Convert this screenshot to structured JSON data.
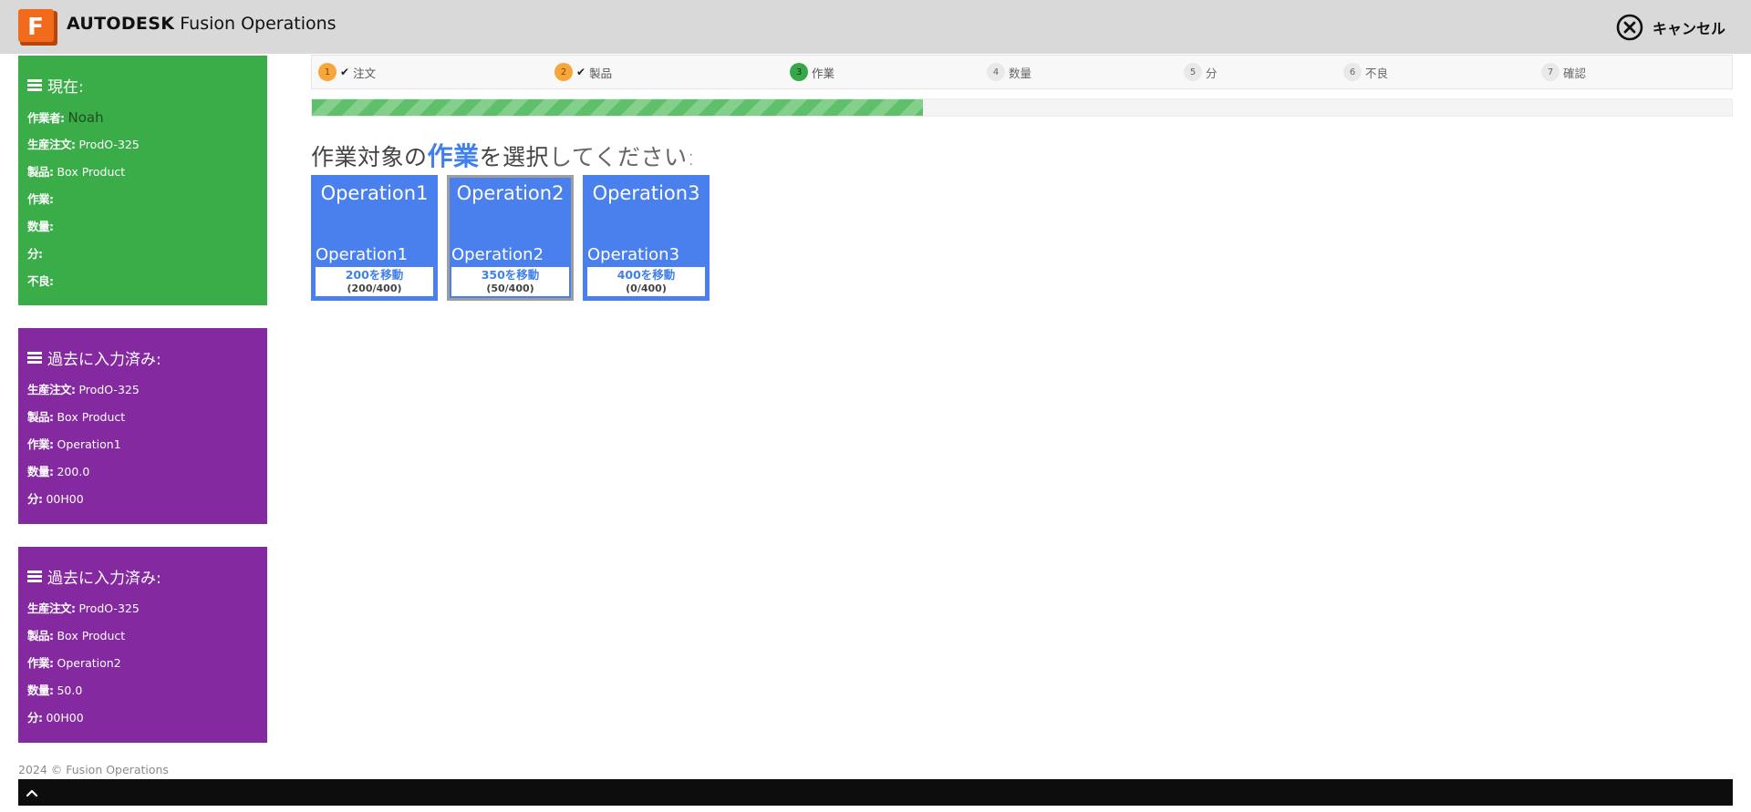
{
  "header": {
    "brand_strong": "AUTODESK",
    "brand_rest": "Fusion Operations",
    "logo_letter": "F",
    "cancel_label": "キャンセル"
  },
  "current": {
    "title": "現在:",
    "worker_label": "作業者:",
    "worker_value": "Noah",
    "order_label": "生産注文:",
    "order_value": "ProdO-325",
    "product_label": "製品:",
    "product_value": "Box Product",
    "operation_label": "作業:",
    "qty_label": "数量:",
    "minutes_label": "分:",
    "defect_label": "不良:"
  },
  "history": [
    {
      "title": "過去に入力済み:",
      "order_label": "生産注文:",
      "order_value": "ProdO-325",
      "product_label": "製品:",
      "product_value": "Box Product",
      "operation_label": "作業:",
      "operation_value": "Operation1",
      "qty_label": "数量:",
      "qty_value": "200.0",
      "minutes_label": "分:",
      "minutes_value": "00H00"
    },
    {
      "title": "過去に入力済み:",
      "order_label": "生産注文:",
      "order_value": "ProdO-325",
      "product_label": "製品:",
      "product_value": "Box Product",
      "operation_label": "作業:",
      "operation_value": "Operation2",
      "qty_label": "数量:",
      "qty_value": "50.0",
      "minutes_label": "分:",
      "minutes_value": "00H00"
    }
  ],
  "steps": [
    {
      "num": "1",
      "label": "注文",
      "state": "done"
    },
    {
      "num": "2",
      "label": "製品",
      "state": "done"
    },
    {
      "num": "3",
      "label": "作業",
      "state": "active"
    },
    {
      "num": "4",
      "label": "数量",
      "state": "pending"
    },
    {
      "num": "5",
      "label": "分",
      "state": "pending"
    },
    {
      "num": "6",
      "label": "不良",
      "state": "pending"
    },
    {
      "num": "7",
      "label": "確認",
      "state": "pending"
    }
  ],
  "progress_fraction": 0.43,
  "prompt": {
    "part1": "作業対象の",
    "highlight": "作業",
    "part2": "を選択",
    "part3": "してください:"
  },
  "operations": [
    {
      "title": "Operation1",
      "name": "Operation1",
      "move": "200を移動",
      "count": "(200/400)",
      "selected": false
    },
    {
      "title": "Operation2",
      "name": "Operation2",
      "move": "350を移動",
      "count": "(50/400)",
      "selected": true
    },
    {
      "title": "Operation3",
      "name": "Operation3",
      "move": "400を移動",
      "count": "(0/400)",
      "selected": false
    }
  ],
  "footer": {
    "copyright": "2024 © Fusion Operations"
  },
  "colors": {
    "accent": "#4a80ee",
    "current_panel": "#3aad49",
    "history_panel": "#8529a0",
    "step_done": "#f6a63b",
    "step_active": "#36a84a"
  },
  "icons": {
    "cancel": "close-circle-icon",
    "panel": "menu-icon",
    "check": "check-icon",
    "scroll_top": "chevron-up-icon"
  }
}
